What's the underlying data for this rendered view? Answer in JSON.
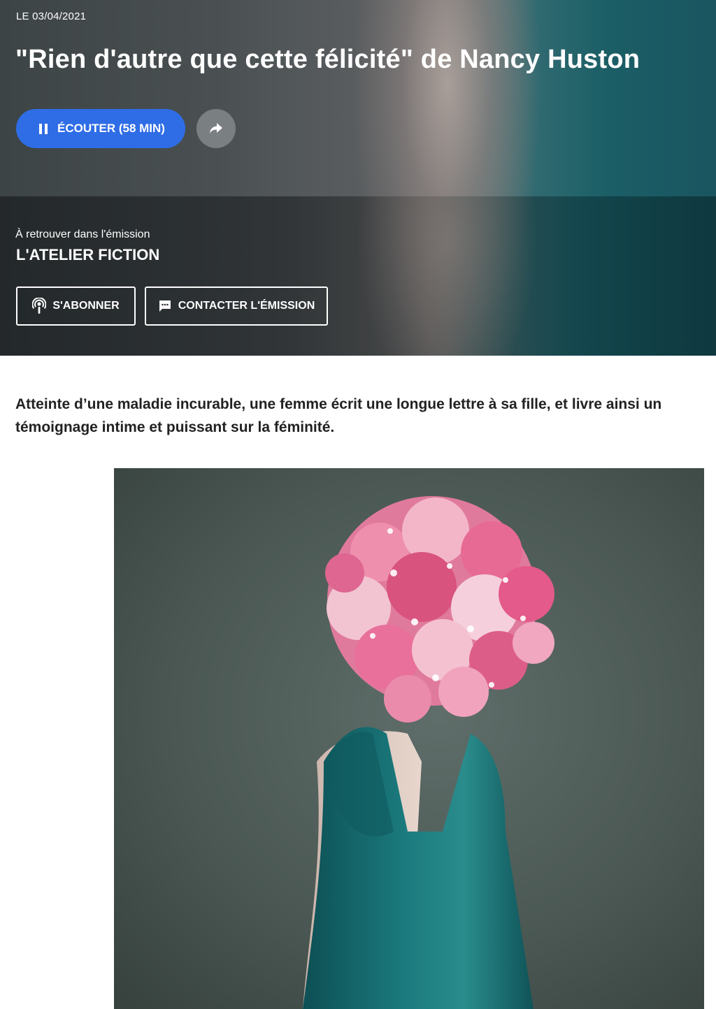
{
  "episode": {
    "date": "LE 03/04/2021",
    "title": "\"Rien d'autre que cette félicité\" de Nancy Huston",
    "listen_label": "ÉCOUTER (58 MIN)"
  },
  "program": {
    "caption": "À retrouver dans l'émission",
    "name": "L'ATELIER FICTION",
    "subscribe_label": "S'ABONNER",
    "contact_label": "CONTACTER L'ÉMISSION"
  },
  "article": {
    "summary": "Atteinte d’une maladie incurable, une femme écrit une longue lettre à sa fille, et livre ainsi un témoignage intime et puissant sur la féminité."
  },
  "colors": {
    "primary_button": "#2f6de6",
    "share_button": "#7a7f82",
    "text_dark": "#222222"
  },
  "icons": {
    "pause": "pause-icon",
    "share": "share-arrow-icon",
    "podcast": "podcast-icon",
    "message": "message-icon"
  }
}
